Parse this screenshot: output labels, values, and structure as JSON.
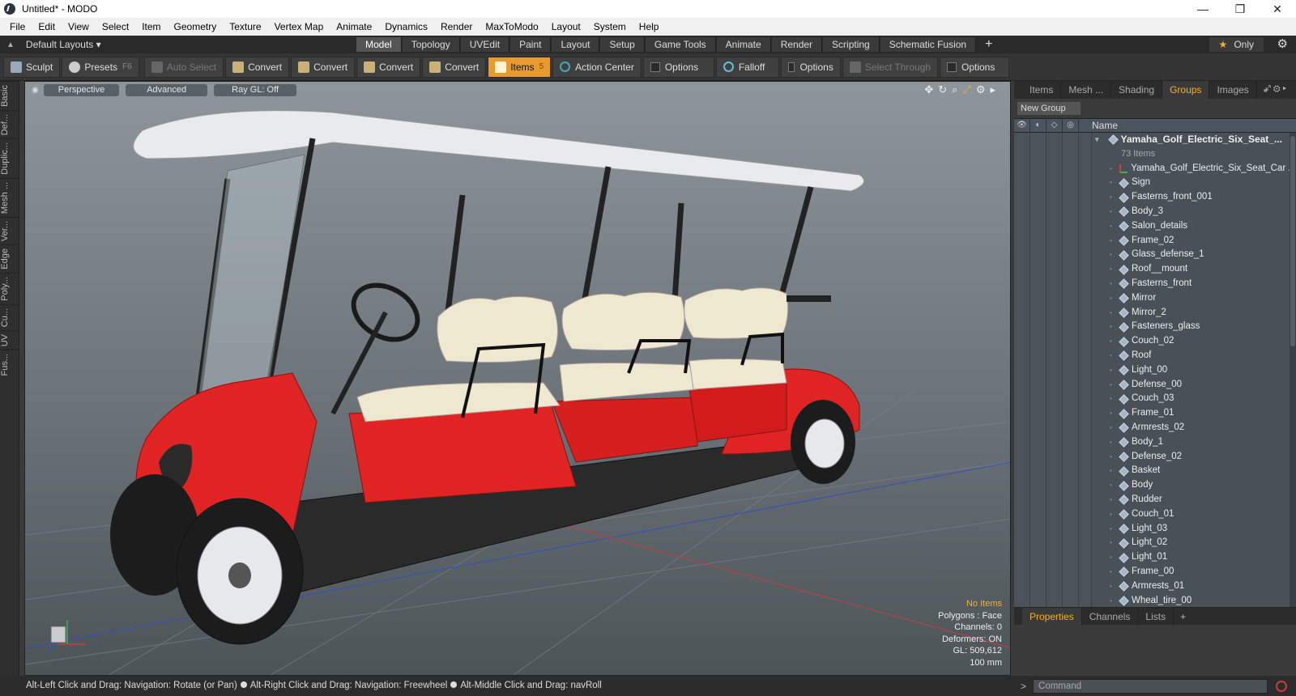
{
  "window": {
    "title": "Untitled* - MODO",
    "controls": [
      "—",
      "❐",
      "✕"
    ]
  },
  "menu": [
    "File",
    "Edit",
    "View",
    "Select",
    "Item",
    "Geometry",
    "Texture",
    "Vertex Map",
    "Animate",
    "Dynamics",
    "Render",
    "MaxToModo",
    "Layout",
    "System",
    "Help"
  ],
  "layouts": {
    "label": "Default Layouts ▾",
    "tabs": [
      "Model",
      "Topology",
      "UVEdit",
      "Paint",
      "Layout",
      "Setup",
      "Game Tools",
      "Animate",
      "Render",
      "Scripting",
      "Schematic Fusion"
    ],
    "active_tab": "Model",
    "plus": "+",
    "only_label": "Only"
  },
  "toolbar": {
    "sculpt": "Sculpt",
    "presets": "Presets",
    "presets_key": "F6",
    "auto_select": "Auto Select",
    "convert1": "Convert",
    "convert2": "Convert",
    "convert3": "Convert",
    "convert4": "Convert",
    "items": "Items",
    "action_center": "Action Center",
    "options1": "Options",
    "falloff": "Falloff",
    "options2": "Options",
    "select_through": "Select Through",
    "options3": "Options"
  },
  "left_tabs": [
    "Basic",
    "Def...",
    "Duplic...",
    "Mesh ...",
    "Ver...",
    "Edge",
    "Poly...",
    "Cu...",
    "UV",
    "Fus..."
  ],
  "viewport": {
    "view_mode": "Perspective",
    "shading": "Advanced",
    "raygl": "Ray GL: Off",
    "stats": {
      "selection": "No Items",
      "polygons": "Polygons : Face",
      "channels": "Channels: 0",
      "deformers": "Deformers: ON",
      "gl": "GL: 509,612",
      "scale": "100 mm"
    }
  },
  "panel": {
    "tabs": [
      "Items",
      "Mesh ...",
      "Shading",
      "Groups",
      "Images"
    ],
    "active_tab": "Groups",
    "new_group": "New Group",
    "name_header": "Name",
    "group_name": "Yamaha_Golf_Electric_Six_Seat_...",
    "group_count": "73 Items",
    "items": [
      "Yamaha_Golf_Electric_Six_Seat_Car ...",
      "Sign",
      "Fasterns_front_001",
      "Body_3",
      "Salon_details",
      "Frame_02",
      "Glass_defense_1",
      "Roof__mount",
      "Fasterns_front",
      "Mirror",
      "Mirror_2",
      "Fasteners_glass",
      "Couch_02",
      "Roof",
      "Light_00",
      "Defense_00",
      "Couch_03",
      "Frame_01",
      "Armrests_02",
      "Body_1",
      "Defense_02",
      "Basket",
      "Body",
      "Rudder",
      "Couch_01",
      "Light_03",
      "Light_02",
      "Light_01",
      "Frame_00",
      "Armrests_01",
      "Wheal_tire_00"
    ],
    "bottom_tabs": [
      "Properties",
      "Channels",
      "Lists"
    ],
    "bottom_active": "Properties"
  },
  "status": {
    "hint1": "Alt-Left Click and Drag: Navigation: Rotate (or Pan)",
    "hint2": "Alt-Right Click and Drag: Navigation: Freewheel",
    "hint3": "Alt-Middle Click and Drag: navRoll",
    "command_placeholder": "Command"
  },
  "colors": {
    "accent": "#f0b030",
    "items_button": "#e89a2c",
    "cart_body": "#e02424",
    "seat": "#efe8d0"
  }
}
